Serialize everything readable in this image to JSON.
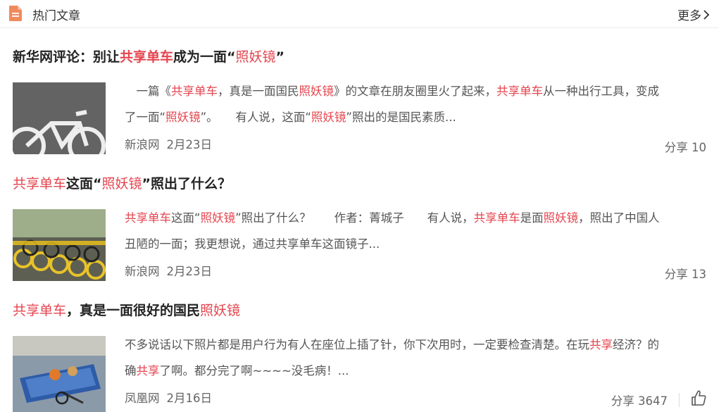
{
  "header": {
    "title": "热门文章",
    "more_label": "更多"
  },
  "articles": [
    {
      "title_parts": [
        "新华网评论：别让",
        "共享单车",
        "成为一面“",
        "照妖镜",
        "”"
      ],
      "excerpt_line1": [
        "　一篇《",
        "共享单车",
        "，真是一面国民",
        "照妖镜",
        "》的文章在朋友圈里火了起来，",
        "共享单车",
        "从一种出行工具，变成"
      ],
      "excerpt_line2": [
        "了一面“",
        "照妖镜",
        "”。　　有人说，这面“",
        "照妖镜",
        "”照出的是国民素质..."
      ],
      "source": "新浪网",
      "date": "2月23日",
      "share_label": "分享",
      "share_count": "10"
    },
    {
      "title_parts": [
        "共享单车",
        "这面“",
        "照妖镜",
        "”照出了什么？"
      ],
      "excerpt_line1": [
        "共享单车",
        "这面“",
        "照妖镜",
        "”照出了什么？　　作者：菁城子　　有人说，",
        "共享单车",
        "是面",
        "照妖镜",
        "，照出了中国人"
      ],
      "excerpt_line2": [
        "丑陋的一面；我更想说，通过共享单车这面镜子..."
      ],
      "source": "新浪网",
      "date": "2月23日",
      "share_label": "分享",
      "share_count": "13"
    },
    {
      "title_parts": [
        "共享单车",
        "，真是一面很好的国民",
        "照妖镜"
      ],
      "excerpt_line1": [
        "不多说话以下照片都是用户行为有人在座位上插了针，你下次用时，一定要检查清楚。在玩",
        "共享",
        "经济？的"
      ],
      "excerpt_line2": [
        "确",
        "共享",
        "了啊。都分完了啊~~~~没毛病！..."
      ],
      "source": "凤凰网",
      "date": "2月16日",
      "share_label": "分享",
      "share_count": "3647"
    }
  ],
  "icons": {
    "header": "document-icon",
    "more": "chevron-right-icon",
    "like": "thumbs-up-icon"
  },
  "colors": {
    "highlight": "#e5454f",
    "icon_orange": "#f08a5d"
  }
}
